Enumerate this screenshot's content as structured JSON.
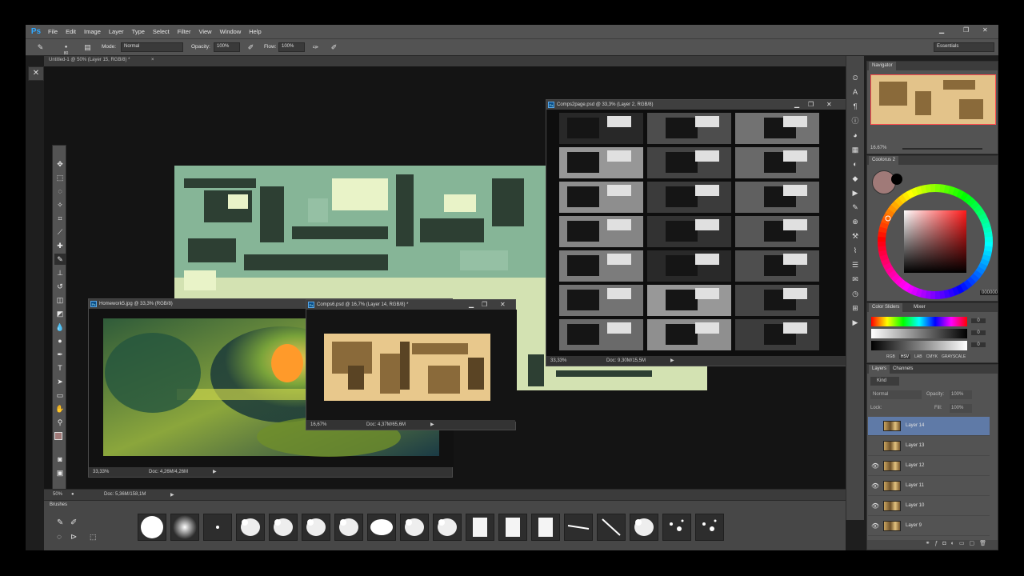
{
  "app": {
    "logo": "Ps"
  },
  "menu": [
    "File",
    "Edit",
    "Image",
    "Layer",
    "Type",
    "Select",
    "Filter",
    "View",
    "Window",
    "Help"
  ],
  "options_bar": {
    "mode_label": "Mode:",
    "mode_value": "Normal",
    "opacity_label": "Opacity:",
    "opacity_value": "100%",
    "flow_label": "Flow:",
    "flow_value": "100%",
    "workspace": "Essentials",
    "brush_size": "80"
  },
  "doc_tab": "Untitled-1 @ 50% (Layer 15, RGB/8) *",
  "main_status": {
    "zoom": "50%",
    "doc": "Doc: 5,36M/158,1M"
  },
  "windows": {
    "comps2page": {
      "title": "Comps2page.psd @ 33,3% (Layer 2, RGB/8)",
      "zoom": "33,33%",
      "doc": "Doc: 9,30M/15,5M"
    },
    "homework": {
      "title": "Homework5.jpg @ 33,3% (RGB/8)",
      "zoom": "33,33%",
      "doc": "Doc: 4,26M/4,26M"
    },
    "comps6": {
      "title": "Comps6.psd @ 16,7% (Layer 14, RGB/8) *",
      "zoom": "16,67%",
      "doc": "Doc: 4,37M/65,6M"
    }
  },
  "brushes_panel": {
    "title": "Brushes"
  },
  "navigator": {
    "tab": "Navigator",
    "zoom": "16.67%"
  },
  "coolorus": {
    "tab": "Coolorus 2",
    "hex": "000000"
  },
  "sliders": {
    "tabs": [
      "Color Sliders",
      "Mixer"
    ],
    "values": [
      "0",
      "0",
      "0"
    ],
    "modes": [
      "RGB",
      "HSV",
      "LAB",
      "CMYK",
      "GRAYSCALE"
    ]
  },
  "layers_panel": {
    "tabs": [
      "Layers",
      "Channels"
    ],
    "kind": "Kind",
    "blend": "Normal",
    "opacity_label": "Opacity:",
    "opacity_value": "100%",
    "lock_label": "Lock:",
    "fill_label": "Fill:",
    "fill_value": "100%",
    "layers": [
      "Layer 14",
      "Layer 13",
      "Layer 12",
      "Layer 11",
      "Layer 10",
      "Layer 9"
    ]
  },
  "colors": {
    "accent": "#31a8ff",
    "selected_layer": "#5f7aa7",
    "canvas_green": "#7fb08d",
    "canvas_pale": "#d9e8b8"
  }
}
